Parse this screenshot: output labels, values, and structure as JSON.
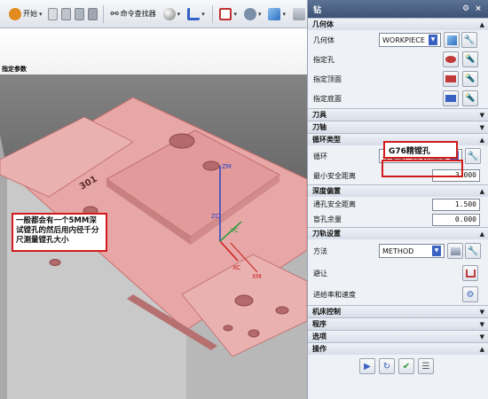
{
  "toolbar": {
    "start_label": "开始",
    "cmd_finder_label": "命令查找器"
  },
  "viewport": {
    "title": "指定参数",
    "callout": "一般都会有一个5MM深试镗孔的然后用内径千分尺测量镗孔大小",
    "axis_labels": {
      "zm": "ZM",
      "zc": "ZC",
      "yc": "YC",
      "xc": "XC",
      "xm": "XM"
    },
    "engraving": "301"
  },
  "panel": {
    "title": "钻",
    "sections": {
      "geometry": "几何体",
      "tool": "刀具",
      "tool_axis": "刀轴",
      "cycle_type": "循环类型",
      "depth_offset": "深度偏置",
      "tool_path_settings": "刀轨设置",
      "machine_control": "机床控制",
      "program": "程序",
      "options": "选项",
      "actions": "操作"
    },
    "geometry": {
      "label": "几何体",
      "value": "WORKPIECE",
      "specify_holes": "指定孔",
      "specify_top": "指定顶面",
      "specify_bottom": "指定底面"
    },
    "cycle": {
      "label": "循环",
      "value": "标准镗，横向偏置后",
      "min_clearance_label": "最小安全距离",
      "min_clearance_value": "3.000",
      "annotation": "G76精镗孔"
    },
    "depth": {
      "through_clearance_label": "通孔安全距离",
      "through_clearance_value": "1.500",
      "blind_stock_label": "盲孔余量",
      "blind_stock_value": "0.000"
    },
    "toolpath": {
      "method_label": "方法",
      "method_value": "METHOD",
      "avoidance_label": "避让",
      "feeds_label": "进给率和速度"
    }
  },
  "colors": {
    "part_pink": "#e8a7a7",
    "part_gray": "#cfcfcf",
    "highlight_red": "#d11b1b",
    "panel_bg": "#eef1f6"
  }
}
